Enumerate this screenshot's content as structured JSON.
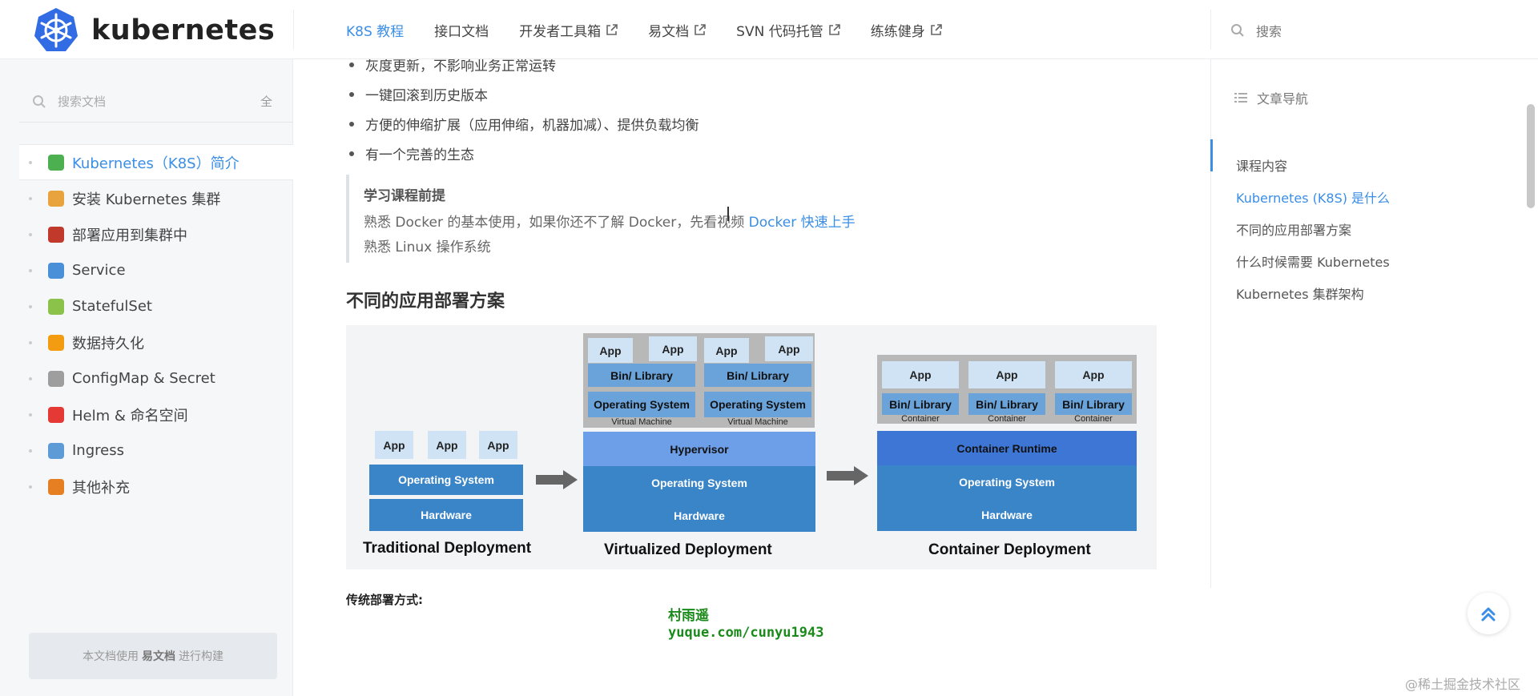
{
  "brand": {
    "name": "kubernetes"
  },
  "nav": {
    "items": [
      {
        "label": "K8S 教程",
        "active": true,
        "external": false
      },
      {
        "label": "接口文档",
        "active": false,
        "external": false
      },
      {
        "label": "开发者工具箱",
        "active": false,
        "external": true
      },
      {
        "label": "易文档",
        "active": false,
        "external": true
      },
      {
        "label": "SVN 代码托管",
        "active": false,
        "external": true
      },
      {
        "label": "练练健身",
        "active": false,
        "external": true
      }
    ],
    "search_label": "搜索"
  },
  "sidebar": {
    "search_placeholder": "搜索文档",
    "search_shortcut": "全",
    "items": [
      {
        "label": "Kubernetes（K8S）简介",
        "active": true,
        "icon": "books-icon",
        "color": "#4caf50"
      },
      {
        "label": "安装 Kubernetes 集群",
        "active": false,
        "icon": "disc-icon",
        "color": "#e8a33d"
      },
      {
        "label": "部署应用到集群中",
        "active": false,
        "icon": "factory-icon",
        "color": "#c0392b"
      },
      {
        "label": "Service",
        "active": false,
        "icon": "masks-icon",
        "color": "#4a90d9"
      },
      {
        "label": "StatefulSet",
        "active": false,
        "icon": "mango-icon",
        "color": "#8bc34a"
      },
      {
        "label": "数据持久化",
        "active": false,
        "icon": "shield-icon",
        "color": "#f39c12"
      },
      {
        "label": "ConfigMap & Secret",
        "active": false,
        "icon": "memo-icon",
        "color": "#9e9e9e"
      },
      {
        "label": "Helm & 命名空间",
        "active": false,
        "icon": "strawberry-icon",
        "color": "#e53935"
      },
      {
        "label": "Ingress",
        "active": false,
        "icon": "airplane-icon",
        "color": "#5c9bd6"
      },
      {
        "label": "其他补充",
        "active": false,
        "icon": "party-icon",
        "color": "#e67e22"
      }
    ],
    "footer": {
      "prefix": "本文档使用",
      "brand": "易文档",
      "suffix": "进行构建"
    }
  },
  "content": {
    "bullets": [
      "灰度更新，不影响业务正常运转",
      "一键回滚到历史版本",
      "方便的伸缩扩展（应用伸缩，机器加减）、提供负载均衡",
      "有一个完善的生态"
    ],
    "quote": {
      "title": "学习课程前提",
      "line1_prefix": "熟悉 Docker 的基本使用，如果你还不了解 Docker，先看视频 ",
      "line1_link": "Docker 快速上手",
      "line2": "熟悉 Linux 操作系统"
    },
    "section_title": "不同的应用部署方案",
    "diagram": {
      "app": "App",
      "os": "Operating System",
      "hardware": "Hardware",
      "bin": "Bin/ Library",
      "vm_label": "Virtual Machine",
      "container_label": "Container",
      "hypervisor": "Hypervisor",
      "runtime": "Container Runtime",
      "captions": [
        "Traditional Deployment",
        "Virtualized Deployment",
        "Container Deployment"
      ],
      "watermark_name": "村雨遥",
      "watermark_url": "yuque.com/cunyu1943"
    },
    "sub_heading": "传统部署方式:"
  },
  "toc": {
    "title": "文章导航",
    "items": [
      {
        "label": "课程内容",
        "active": false
      },
      {
        "label": "Kubernetes (K8S) 是什么",
        "active": true
      },
      {
        "label": "不同的应用部署方案",
        "active": false
      },
      {
        "label": "什么时候需要 Kubernetes",
        "active": false
      },
      {
        "label": "Kubernetes 集群架构",
        "active": false
      }
    ]
  },
  "footer_watermark": "@稀土掘金技术社区"
}
